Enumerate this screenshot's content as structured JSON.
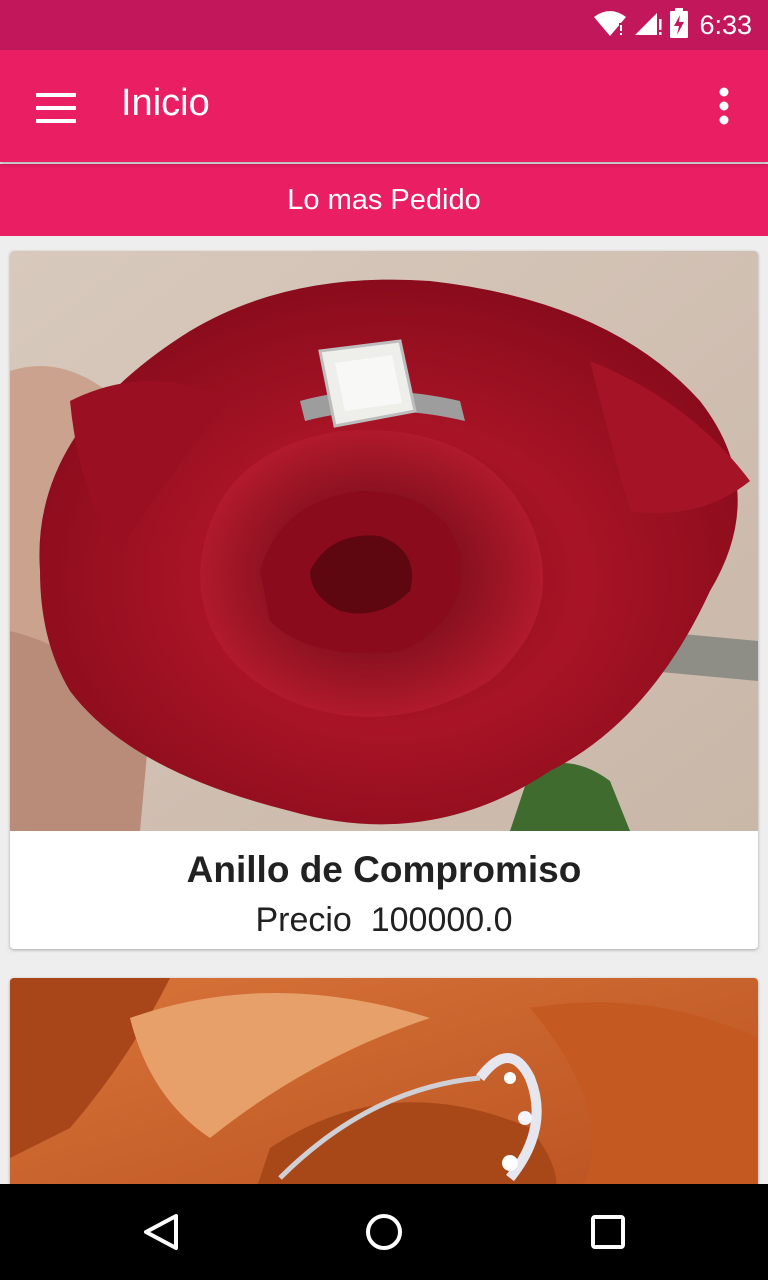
{
  "status_bar": {
    "time": "6:33",
    "icons": [
      "wifi-icon",
      "signal-icon",
      "battery-charging-icon"
    ],
    "color": "#c2185b"
  },
  "app_bar": {
    "title": "Inicio",
    "menu_icon": "hamburger-menu-icon",
    "overflow_icon": "more-vert-icon",
    "color": "#e91e63"
  },
  "section": {
    "title": "Lo mas Pedido"
  },
  "products": [
    {
      "name": "Anillo de Compromiso",
      "price_text": "Precio  100000.0",
      "image": "red-rose-engagement-ring"
    },
    {
      "image": "orange-rose-diamond-ring"
    }
  ],
  "nav_bar": {
    "icons": [
      "back-icon",
      "home-icon",
      "recents-icon"
    ]
  }
}
